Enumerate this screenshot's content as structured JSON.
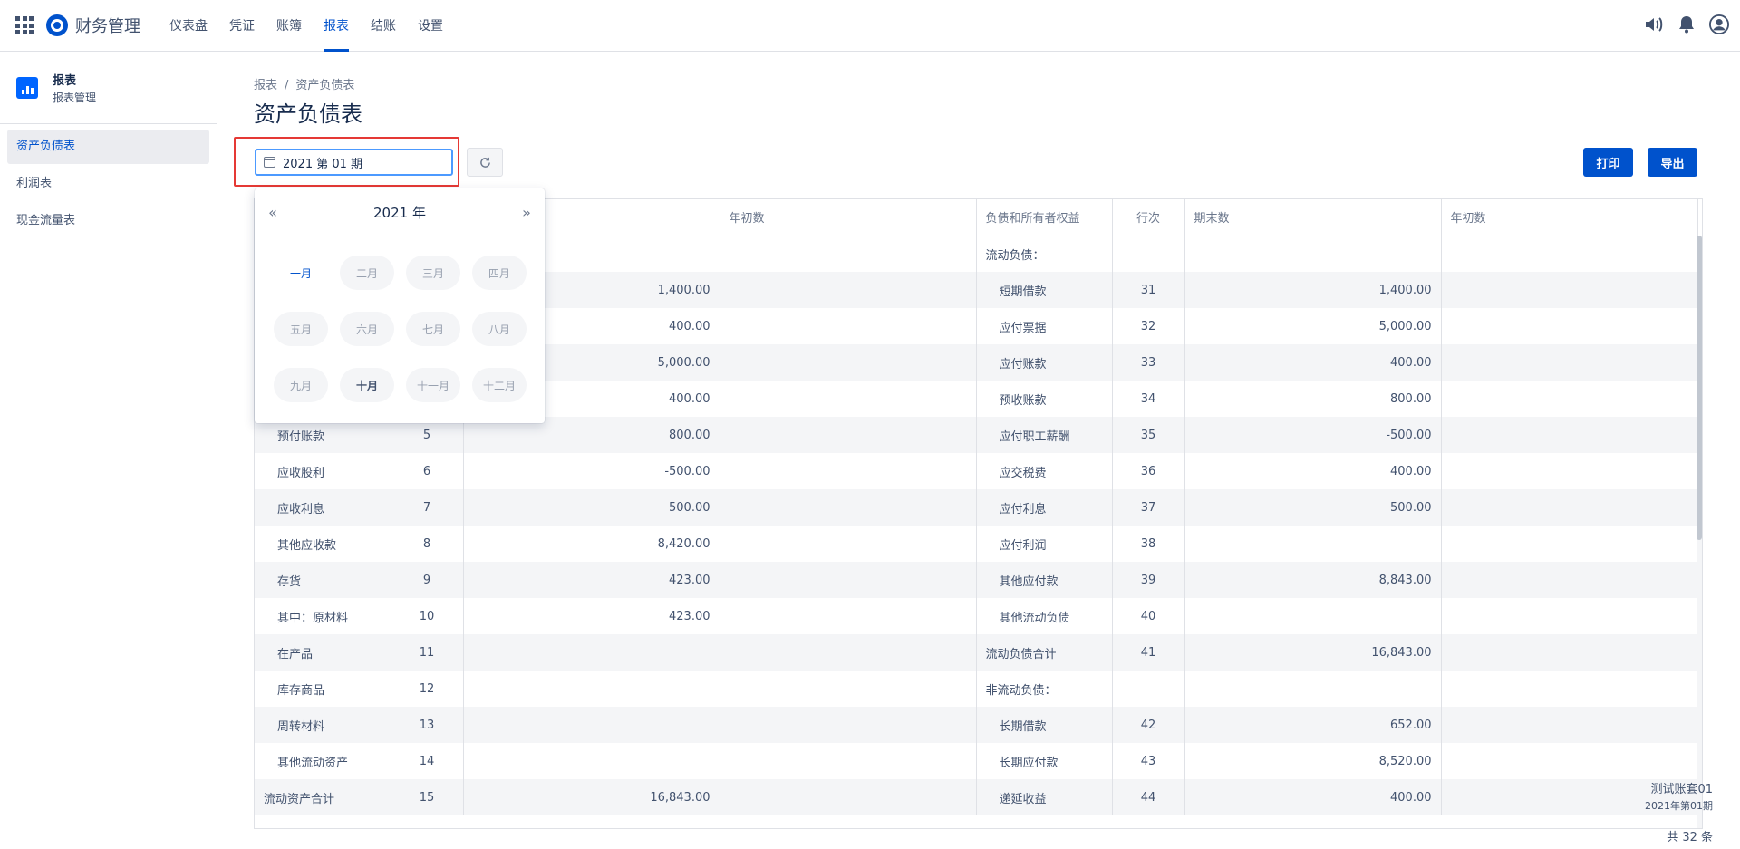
{
  "app": {
    "title": "财务管理"
  },
  "nav": [
    "仪表盘",
    "凭证",
    "账簿",
    "报表",
    "结账",
    "设置"
  ],
  "sidebar": {
    "title": "报表",
    "subtitle": "报表管理",
    "items": [
      "资产负债表",
      "利润表",
      "现金流量表"
    ]
  },
  "breadcrumb": {
    "parent": "报表",
    "sep": "/",
    "current": "资产负债表"
  },
  "page": {
    "title": "资产负债表"
  },
  "toolbar": {
    "period": "2021 第 01 期",
    "print": "打印",
    "export": "导出"
  },
  "month_picker": {
    "year": "2021 年",
    "prev": "«",
    "next": "»",
    "months": [
      "一月",
      "二月",
      "三月",
      "四月",
      "五月",
      "六月",
      "七月",
      "八月",
      "九月",
      "十月",
      "十一月",
      "十二月"
    ]
  },
  "table": {
    "headers": [
      "",
      "",
      "",
      "年初数",
      "负债和所有者权益",
      "行次",
      "期末数",
      "年初数"
    ],
    "rows": [
      [
        "",
        "",
        "",
        "",
        "流动负债：",
        "",
        "",
        ""
      ],
      [
        "",
        "",
        "1,400.00",
        "",
        "短期借款",
        "31",
        "1,400.00",
        ""
      ],
      [
        "",
        "",
        "400.00",
        "",
        "应付票据",
        "32",
        "5,000.00",
        ""
      ],
      [
        "",
        "",
        "5,000.00",
        "",
        "应付账款",
        "33",
        "400.00",
        ""
      ],
      [
        "",
        "",
        "400.00",
        "",
        "预收账款",
        "34",
        "800.00",
        ""
      ],
      [
        "预付账款",
        "5",
        "800.00",
        "",
        "应付职工薪酬",
        "35",
        "-500.00",
        ""
      ],
      [
        "应收股利",
        "6",
        "-500.00",
        "",
        "应交税费",
        "36",
        "400.00",
        ""
      ],
      [
        "应收利息",
        "7",
        "500.00",
        "",
        "应付利息",
        "37",
        "500.00",
        ""
      ],
      [
        "其他应收款",
        "8",
        "8,420.00",
        "",
        "应付利润",
        "38",
        "",
        ""
      ],
      [
        "存货",
        "9",
        "423.00",
        "",
        "其他应付款",
        "39",
        "8,843.00",
        ""
      ],
      [
        "其中：原材料",
        "10",
        "423.00",
        "",
        "其他流动负债",
        "40",
        "",
        ""
      ],
      [
        "在产品",
        "11",
        "",
        "",
        "流动负债合计",
        "41",
        "16,843.00",
        ""
      ],
      [
        "库存商品",
        "12",
        "",
        "",
        "非流动负债：",
        "",
        "",
        ""
      ],
      [
        "周转材料",
        "13",
        "",
        "",
        "长期借款",
        "42",
        "652.00",
        ""
      ],
      [
        "其他流动资产",
        "14",
        "",
        "",
        "长期应付款",
        "43",
        "8,520.00",
        ""
      ],
      [
        "流动资产合计",
        "15",
        "16,843.00",
        "",
        "递延收益",
        "44",
        "400.00",
        ""
      ]
    ]
  },
  "footer": {
    "account": "测试账套01",
    "period": "2021年第01期",
    "total": "共 32 条"
  }
}
